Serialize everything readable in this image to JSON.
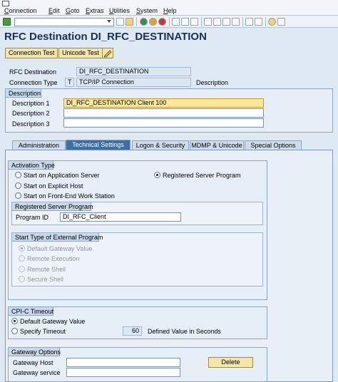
{
  "menu": [
    "Connection",
    "Edit",
    "Goto",
    "Extras",
    "Utilities",
    "System",
    "Help"
  ],
  "title": "RFC Destination DI_RFC_DESTINATION",
  "buttons": {
    "connection_test": "Connection Test",
    "unicode_test": "Unicode Test"
  },
  "header": {
    "rfc_destination_label": "RFC Destination",
    "rfc_destination_value": "DI_RFC_DESTINATION",
    "connection_type_label": "Connection Type",
    "connection_type_code": "T",
    "connection_type_value": "TCP/IP Connection",
    "description_label": "Description"
  },
  "description": {
    "title": "Description",
    "d1_label": "Description 1",
    "d1_value": "DI_RFC_DESTINATION Client 100",
    "d2_label": "Description 2",
    "d2_value": "",
    "d3_label": "Description 3",
    "d3_value": ""
  },
  "tabs": [
    "Administration",
    "Technical Settings",
    "Logon & Security",
    "MDMP & Unicode",
    "Special Options"
  ],
  "active_tab": "Technical Settings",
  "activation": {
    "title": "Activation Type",
    "opt1": "Start on Application Server",
    "opt2": "Registered Server Program",
    "opt3": "Start on Explicit Host",
    "opt4": "Start on Front-End Work Station",
    "selected": "Registered Server Program"
  },
  "registered": {
    "title": "Registered Server Program",
    "program_id_label": "Program ID",
    "program_id_value": "DI_RFC_Client"
  },
  "start_type": {
    "title": "Start Type of External Program",
    "options": [
      "Default Gateway Value",
      "Remote Execution",
      "Remote Shell",
      "Secure Shell"
    ],
    "selected": "Default Gateway Value"
  },
  "cpic": {
    "title": "CPI-C Timeout",
    "opt1": "Default Gateway Value",
    "opt2": "Specify Timeout",
    "selected": "Default Gateway Value",
    "timeout_value": "60",
    "timeout_note": "Defined Value in Seconds"
  },
  "gateway": {
    "title": "Gateway Options",
    "host_label": "Gateway Host",
    "host_value": "",
    "service_label": "Gateway service",
    "service_value": "",
    "delete_label": "Delete"
  }
}
